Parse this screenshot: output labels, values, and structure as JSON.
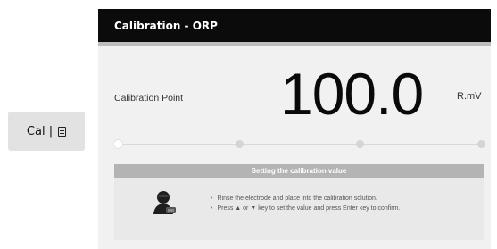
{
  "side_key": {
    "label": "Cal |",
    "icon": "document-icon"
  },
  "screen": {
    "title": "Calibration - ORP",
    "calibration_point_label": "Calibration Point",
    "value": "100.0",
    "unit": "R.mV",
    "progress": {
      "steps": 4,
      "current": 1
    },
    "panel": {
      "header": "Setting the calibration value",
      "icon": "technician-icon",
      "instructions": [
        "Rinse the electrode and place into the calibration solution.",
        "Press ▲ or ▼ key to set the value and press Enter key to confirm."
      ]
    }
  },
  "colors": {
    "titlebar": "#0b0b0b",
    "screen_bg": "#f1f1f1",
    "panel_header": "#b4b4b4"
  }
}
